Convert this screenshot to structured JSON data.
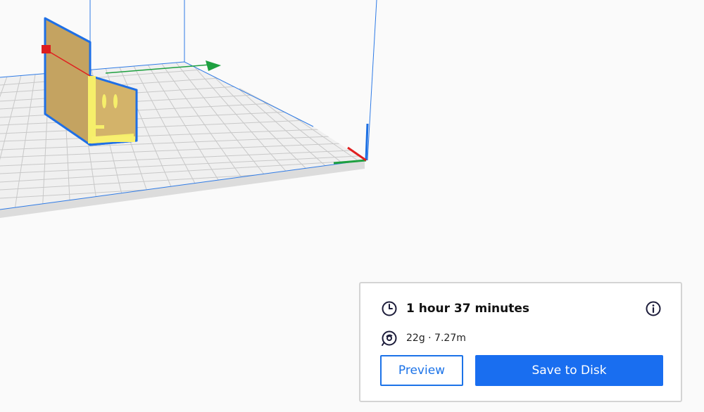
{
  "print_estimate": {
    "time_label": "1 hour 37 minutes",
    "material_label": "22g · 7.27m",
    "time_icon": "clock-icon",
    "material_icon": "filament-spool-icon",
    "info_icon": "info-icon"
  },
  "actions": {
    "preview_label": "Preview",
    "save_label": "Save to Disk"
  },
  "colors": {
    "accent": "#196ef0",
    "model_fill": "#c4a361",
    "model_outline": "#1f6fe5",
    "build_plate": "#f0f0f0",
    "grid_line": "#c8c8c8",
    "axis_x": "#e02020",
    "axis_y": "#1ea040",
    "axis_z": "#1c6fe3"
  }
}
